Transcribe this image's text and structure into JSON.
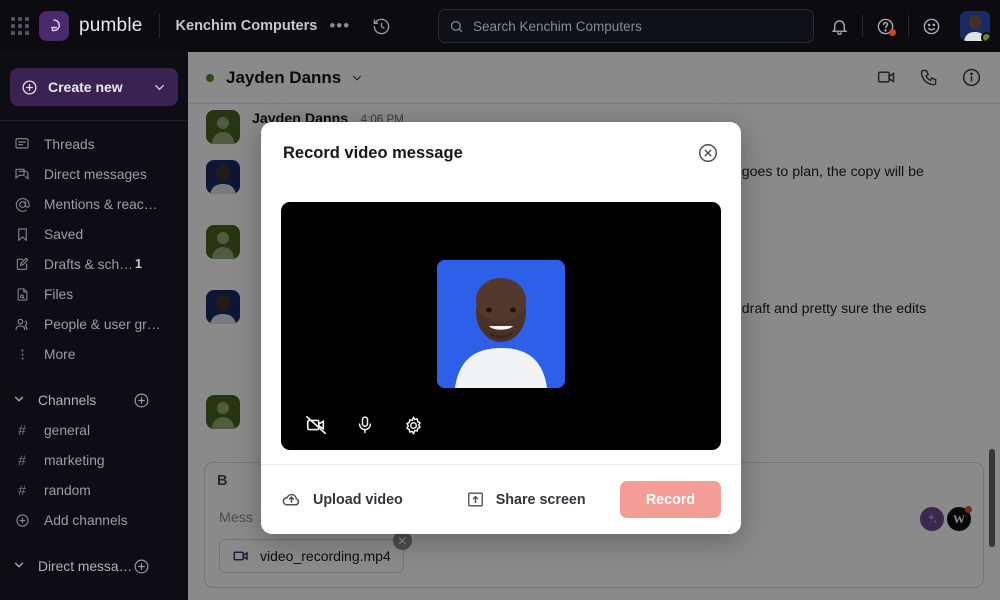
{
  "topbar": {
    "logo_text": "pumble",
    "workspace": "Kenchim Computers",
    "more_dots": "•••",
    "history_icon": "history-icon",
    "search": {
      "placeholder": "Search Kenchim Computers",
      "icon": "search-icon"
    },
    "bell_icon": "bell-icon",
    "help_icon": "help-icon",
    "emoji_icon": "emoji-icon",
    "avatar_icon": "user-avatar"
  },
  "sidebar": {
    "create_new": "Create new",
    "items": [
      {
        "label": "Threads",
        "icon": "threads-icon",
        "badge": ""
      },
      {
        "label": "Direct messages",
        "icon": "direct-messages-icon",
        "badge": ""
      },
      {
        "label": "Mentions & reac…",
        "icon": "mentions-icon",
        "badge": ""
      },
      {
        "label": "Saved",
        "icon": "bookmark-icon",
        "badge": ""
      },
      {
        "label": "Drafts & sch…",
        "icon": "drafts-icon",
        "badge": "1"
      },
      {
        "label": "Files",
        "icon": "files-icon",
        "badge": ""
      },
      {
        "label": "People & user gr…",
        "icon": "people-icon",
        "badge": ""
      },
      {
        "label": "More",
        "icon": "more-icon",
        "badge": ""
      }
    ],
    "channels_group": "Channels",
    "channels": [
      {
        "label": "general"
      },
      {
        "label": "marketing"
      },
      {
        "label": "random"
      }
    ],
    "add_channels": "Add channels",
    "dm_group": "Direct messa…"
  },
  "chat": {
    "header": {
      "name": "Jayden Danns",
      "status": "online",
      "video_icon": "video-call-icon",
      "call_icon": "phone-call-icon",
      "info_icon": "info-icon"
    },
    "messages": [
      {
        "name": "Jayden Danns",
        "time": "4:06 PM",
        "text": ""
      },
      {
        "text": "ng goes to plan, the copy will be"
      },
      {
        "text": "rst draft and pretty sure the edits"
      }
    ],
    "composer": {
      "bold_label": "B",
      "placeholder": "Mess",
      "ai_icon": "ai-sparkle-icon",
      "w_badge": "W",
      "attachment": {
        "filename": "video_recording.mp4",
        "icon": "video-file-icon",
        "remove": "✕"
      }
    }
  },
  "modal": {
    "title": "Record video message",
    "close_icon": "close-icon",
    "controls": [
      {
        "icon": "camera-off-icon"
      },
      {
        "icon": "microphone-icon"
      },
      {
        "icon": "settings-gear-icon"
      }
    ],
    "upload_label": "Upload video",
    "upload_icon": "cloud-upload-icon",
    "share_label": "Share screen",
    "share_icon": "share-screen-icon",
    "record_label": "Record"
  },
  "colors": {
    "brand_purple": "#4a2a6b",
    "create_new_bg": "#3a2352",
    "record_btn": "#f49c96",
    "online_green": "#4f8f29",
    "video_bg_blue": "#2d5fe8"
  }
}
